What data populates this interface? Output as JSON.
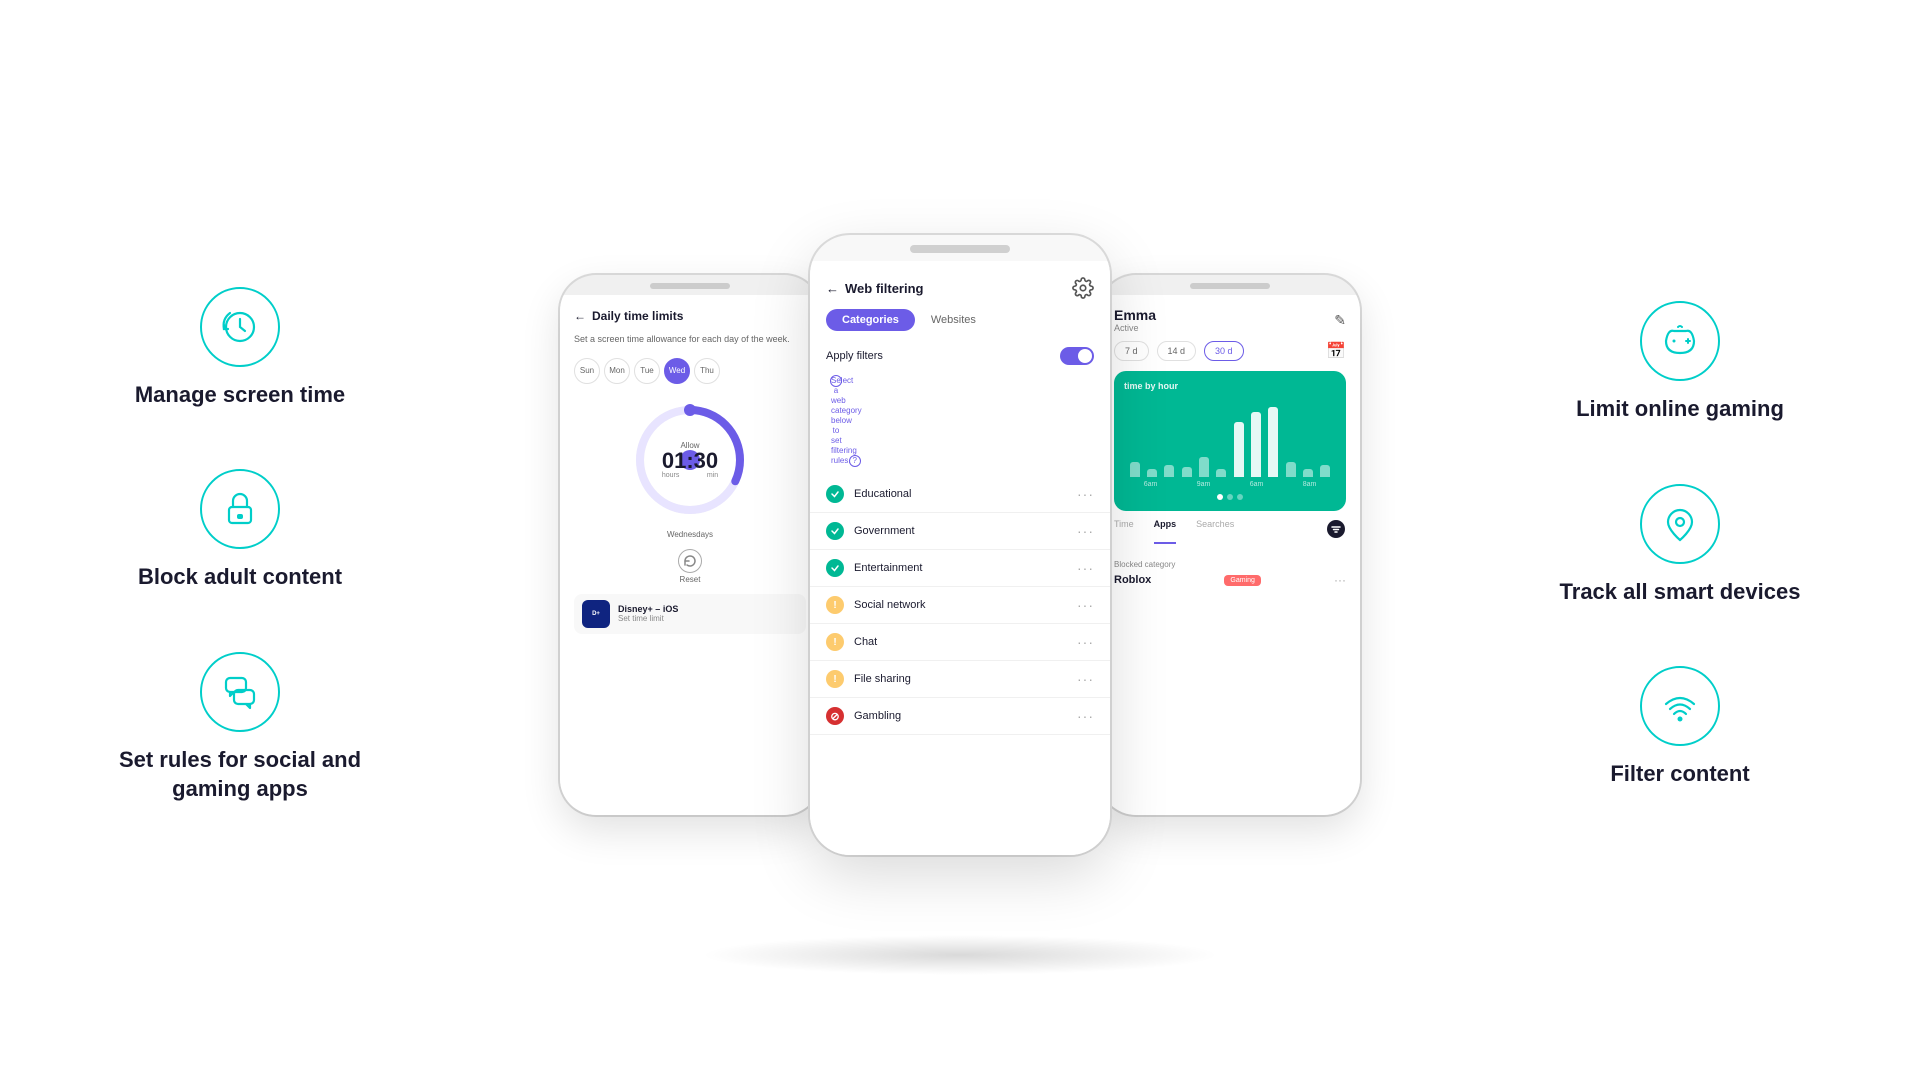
{
  "left": {
    "features": [
      {
        "id": "screen-time",
        "icon": "clock-icon",
        "text": "Manage screen time"
      },
      {
        "id": "adult-content",
        "icon": "lock-icon",
        "text": "Block adult content"
      },
      {
        "id": "social-gaming",
        "icon": "chat-icon",
        "text": "Set rules for social and gaming apps"
      }
    ]
  },
  "right": {
    "features": [
      {
        "id": "online-gaming",
        "icon": "gamepad-icon",
        "text": "Limit online gaming"
      },
      {
        "id": "smart-devices",
        "icon": "location-icon",
        "text": "Track all smart devices"
      },
      {
        "id": "filter-content",
        "icon": "wifi-icon",
        "text": "Filter content"
      }
    ]
  },
  "phone_left": {
    "header": "Daily time limits",
    "subtitle": "Set a screen time allowance for each day of the week.",
    "days": [
      "Sun",
      "Mon",
      "Tue",
      "Wed",
      "Thu"
    ],
    "active_day": "Wed",
    "allow_label": "Allow",
    "time_value": "01:30",
    "hours_label": "hours",
    "min_label": "min",
    "day_label": "Wednesdays",
    "reset_label": "Reset",
    "app_name": "Disney+",
    "app_platform": "iOS",
    "app_action": "Set time limit"
  },
  "phone_main": {
    "title": "Web filtering",
    "tab_categories": "Categories",
    "tab_websites": "Websites",
    "apply_label": "Apply filters",
    "select_text": "Select a web category below to set filtering rules.",
    "categories": [
      {
        "name": "Educational",
        "status": "check"
      },
      {
        "name": "Government",
        "status": "check"
      },
      {
        "name": "Entertainment",
        "status": "check"
      },
      {
        "name": "Social network",
        "status": "warn"
      },
      {
        "name": "Chat",
        "status": "warn"
      },
      {
        "name": "File sharing",
        "status": "warn"
      },
      {
        "name": "Gambling",
        "status": "block"
      }
    ]
  },
  "phone_right": {
    "user_name": "Emma",
    "status": "Active",
    "time_ranges": [
      "7 d",
      "14 d",
      "30 d"
    ],
    "chart_title": "time by hour",
    "chart_labels": [
      "6am",
      "9am",
      "6am",
      "8am"
    ],
    "nav_tabs": [
      "Time",
      "Apps",
      "Searches"
    ],
    "blocked_label": "Blocked category",
    "blocked_app": "Roblox",
    "blocked_tag": "Gaming"
  }
}
